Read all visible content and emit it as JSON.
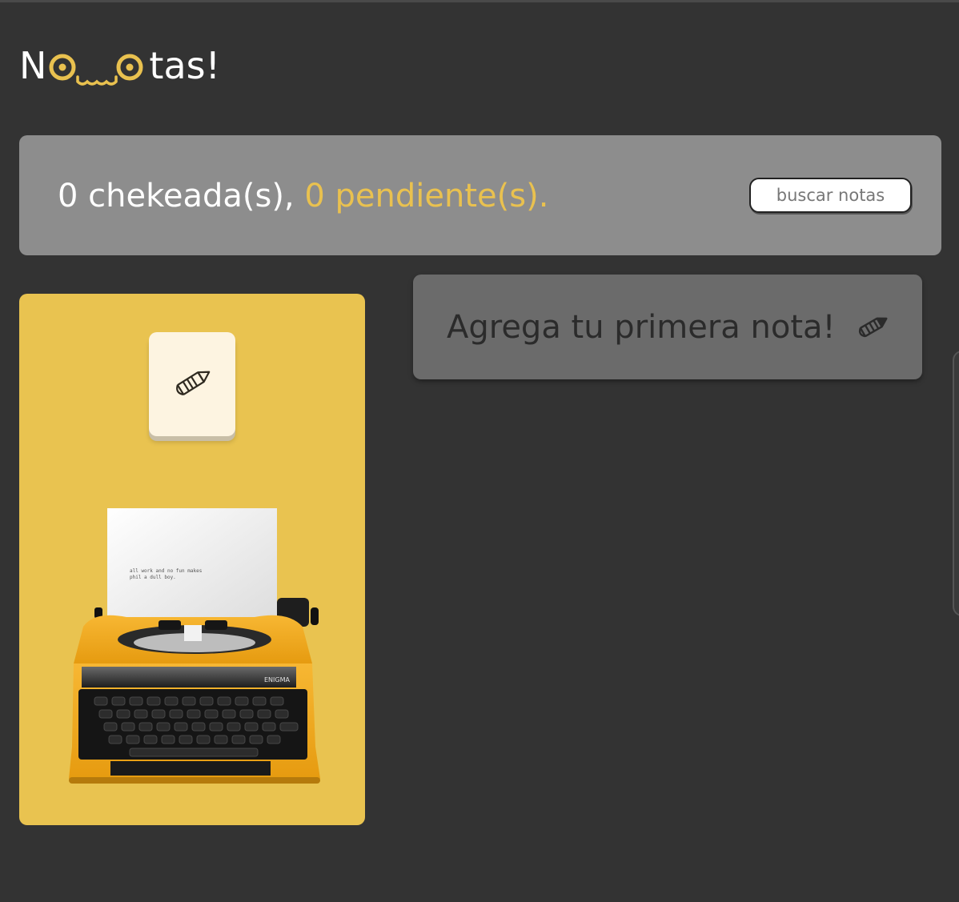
{
  "app": {
    "logo_start": "N",
    "logo_end": "tas!",
    "accent": "#e9c14f"
  },
  "summary": {
    "checked_text": "0 chekeada(s),",
    "pending_text": "0 pendiente(s).",
    "search_placeholder": "buscar notas"
  },
  "note_card": {
    "background": "#e9c350",
    "add_icon": "pencil-icon",
    "typewriter_brand": "ENIGMA",
    "paper_line_1": "all work and no fun makes",
    "paper_line_2": "phil a dull boy."
  },
  "empty_state": {
    "message": "Agrega tu primera nota!",
    "icon": "pencil-icon"
  }
}
